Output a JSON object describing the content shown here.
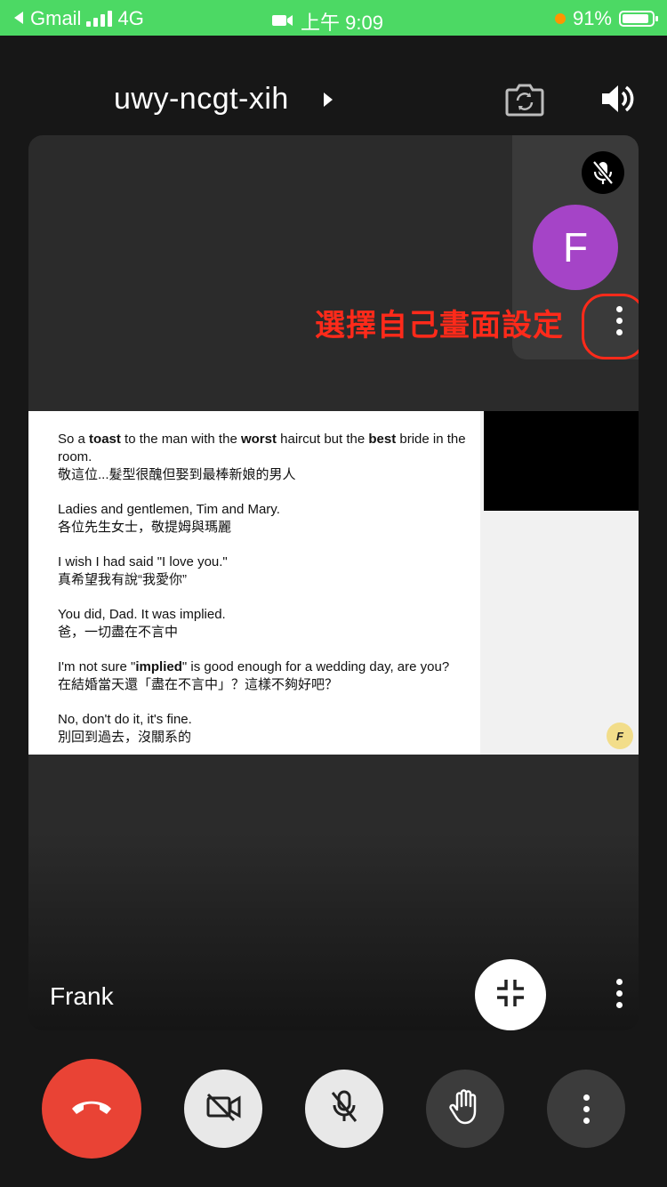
{
  "status_bar": {
    "back_app": "Gmail",
    "network": "4G",
    "time": "上午 9:09",
    "battery": "91%"
  },
  "header": {
    "meeting_code": "uwy-ncgt-xih"
  },
  "annotation": {
    "text": "選擇自己畫面設定",
    "color": "#ff2a1a"
  },
  "self_view": {
    "avatar_letter": "F",
    "avatar_color": "#a544c7"
  },
  "participant": {
    "name": "Frank"
  },
  "shared_screen": {
    "logo_text": "F",
    "subtitles": [
      {
        "en_parts": [
          [
            "So a ",
            false
          ],
          [
            "toast",
            true
          ],
          [
            " to the man with the ",
            false
          ],
          [
            "worst",
            true
          ],
          [
            " haircut but the ",
            false
          ],
          [
            "best",
            true
          ],
          [
            " bride in the room.",
            false
          ]
        ],
        "zh": "敬這位...髮型很醜但娶到最棒新娘的男人"
      },
      {
        "en_parts": [
          [
            "Ladies and gentlemen, Tim and Mary.",
            false
          ]
        ],
        "zh": "各位先生女士，敬提姆與瑪麗"
      },
      {
        "en_parts": [
          [
            "I wish I had said \"I love you.\"",
            false
          ]
        ],
        "zh": "真希望我有說“我愛你”"
      },
      {
        "en_parts": [
          [
            "You did, Dad. It was implied.",
            false
          ]
        ],
        "zh": "爸，一切盡在不言中"
      },
      {
        "en_parts": [
          [
            "I'm not sure \"",
            false
          ],
          [
            "implied",
            true
          ],
          [
            "\" is good enough for a wedding day, are you?",
            false
          ]
        ],
        "zh": "在結婚當天還「盡在不言中」？這樣不夠好吧？"
      },
      {
        "en_parts": [
          [
            "No, don't do it, it's fine.",
            false
          ]
        ],
        "zh": "別回到過去，沒關系的"
      }
    ]
  },
  "icons": {
    "back": "back-arrow-icon",
    "signal": "signal-bars-icon",
    "video_status": "video-camera-icon",
    "switch_camera": "switch-camera-icon",
    "speaker": "speaker-icon",
    "mic_off": "mic-off-icon",
    "minimize": "minimize-icon",
    "end_call": "phone-hangup-icon",
    "camera_off": "camera-off-icon",
    "raise_hand": "raise-hand-icon",
    "more": "more-vertical-icon"
  },
  "colors": {
    "status_bar": "#4cd964",
    "end_call": "#e94335"
  }
}
